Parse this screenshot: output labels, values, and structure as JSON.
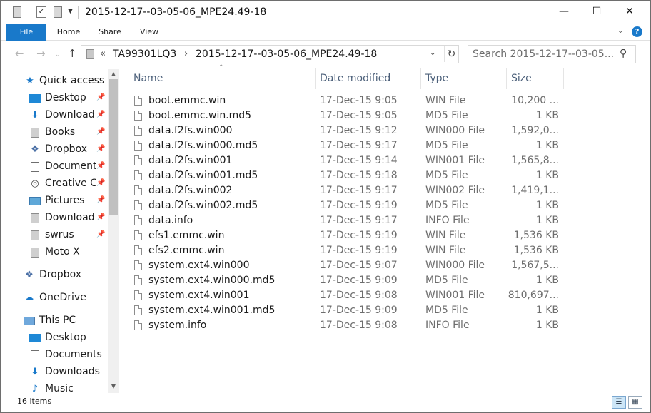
{
  "window": {
    "title": "2015-12-17--03-05-06_MPE24.49-18",
    "controls": {
      "minimize": "—",
      "maximize": "☐",
      "close": "✕"
    }
  },
  "ribbon": {
    "tabs": [
      {
        "label": "File",
        "active": true
      },
      {
        "label": "Home"
      },
      {
        "label": "Share"
      },
      {
        "label": "View"
      }
    ],
    "expand_icon": "chevron-down-icon",
    "help_icon": "help-icon"
  },
  "nav": {
    "back_icon": "arrow-left-icon",
    "forward_icon": "arrow-right-icon",
    "recent_icon": "chevron-down-icon",
    "up_icon": "arrow-up-icon",
    "breadcrumb": {
      "overflow": "«",
      "segments": [
        "TA99301LQ3",
        "2015-12-17--03-05-06_MPE24.49-18"
      ],
      "separator": "›"
    },
    "search_placeholder": "Search 2015-12-17--03-05...",
    "search_value": ""
  },
  "sidebar": {
    "items": [
      {
        "label": "Quick access",
        "icon": "star-icon",
        "level": 0,
        "pinned": false
      },
      {
        "label": "Desktop",
        "icon": "desktop-icon",
        "level": 1,
        "pinned": true
      },
      {
        "label": "Download",
        "icon": "download-icon",
        "level": 1,
        "pinned": true
      },
      {
        "label": "Books",
        "icon": "folder-icon",
        "level": 1,
        "pinned": true
      },
      {
        "label": "Dropbox",
        "icon": "dropbox-icon",
        "level": 1,
        "pinned": true
      },
      {
        "label": "Document",
        "icon": "documents-icon",
        "level": 1,
        "pinned": true
      },
      {
        "label": "Creative C",
        "icon": "creative-cloud-icon",
        "level": 1,
        "pinned": true
      },
      {
        "label": "Pictures",
        "icon": "pictures-icon",
        "level": 1,
        "pinned": true
      },
      {
        "label": "Download",
        "icon": "folder-icon",
        "level": 1,
        "pinned": true
      },
      {
        "label": "swrus",
        "icon": "folder-icon",
        "level": 1,
        "pinned": true
      },
      {
        "label": "Moto X",
        "icon": "folder-icon",
        "level": 1,
        "pinned": false
      },
      {
        "label": "Dropbox",
        "icon": "dropbox-icon",
        "level": 0,
        "pinned": false
      },
      {
        "label": "OneDrive",
        "icon": "onedrive-icon",
        "level": 0,
        "pinned": false
      },
      {
        "label": "This PC",
        "icon": "computer-icon",
        "level": 0,
        "pinned": false
      },
      {
        "label": "Desktop",
        "icon": "desktop-icon",
        "level": 1,
        "pinned": false
      },
      {
        "label": "Documents",
        "icon": "documents-icon",
        "level": 1,
        "pinned": false
      },
      {
        "label": "Downloads",
        "icon": "download-icon",
        "level": 1,
        "pinned": false
      },
      {
        "label": "Music",
        "icon": "music-icon",
        "level": 1,
        "pinned": false
      }
    ]
  },
  "filelist": {
    "columns": [
      {
        "label": "Name"
      },
      {
        "label": "Date modified"
      },
      {
        "label": "Type"
      },
      {
        "label": "Size"
      }
    ],
    "sort_indicator": "^",
    "rows": [
      {
        "name": "boot.emmc.win",
        "date": "17-Dec-15 9:05",
        "type": "WIN File",
        "size": "10,200 ..."
      },
      {
        "name": "boot.emmc.win.md5",
        "date": "17-Dec-15 9:05",
        "type": "MD5 File",
        "size": "1 KB"
      },
      {
        "name": "data.f2fs.win000",
        "date": "17-Dec-15 9:12",
        "type": "WIN000 File",
        "size": "1,592,0..."
      },
      {
        "name": "data.f2fs.win000.md5",
        "date": "17-Dec-15 9:17",
        "type": "MD5 File",
        "size": "1 KB"
      },
      {
        "name": "data.f2fs.win001",
        "date": "17-Dec-15 9:14",
        "type": "WIN001 File",
        "size": "1,565,8..."
      },
      {
        "name": "data.f2fs.win001.md5",
        "date": "17-Dec-15 9:18",
        "type": "MD5 File",
        "size": "1 KB"
      },
      {
        "name": "data.f2fs.win002",
        "date": "17-Dec-15 9:17",
        "type": "WIN002 File",
        "size": "1,419,1..."
      },
      {
        "name": "data.f2fs.win002.md5",
        "date": "17-Dec-15 9:19",
        "type": "MD5 File",
        "size": "1 KB"
      },
      {
        "name": "data.info",
        "date": "17-Dec-15 9:17",
        "type": "INFO File",
        "size": "1 KB"
      },
      {
        "name": "efs1.emmc.win",
        "date": "17-Dec-15 9:19",
        "type": "WIN File",
        "size": "1,536 KB"
      },
      {
        "name": "efs2.emmc.win",
        "date": "17-Dec-15 9:19",
        "type": "WIN File",
        "size": "1,536 KB"
      },
      {
        "name": "system.ext4.win000",
        "date": "17-Dec-15 9:07",
        "type": "WIN000 File",
        "size": "1,567,5..."
      },
      {
        "name": "system.ext4.win000.md5",
        "date": "17-Dec-15 9:09",
        "type": "MD5 File",
        "size": "1 KB"
      },
      {
        "name": "system.ext4.win001",
        "date": "17-Dec-15 9:08",
        "type": "WIN001 File",
        "size": "810,697..."
      },
      {
        "name": "system.ext4.win001.md5",
        "date": "17-Dec-15 9:09",
        "type": "MD5 File",
        "size": "1 KB"
      },
      {
        "name": "system.info",
        "date": "17-Dec-15 9:08",
        "type": "INFO File",
        "size": "1 KB"
      }
    ]
  },
  "status": {
    "item_count": "16 items"
  },
  "colors": {
    "accent": "#1979ca",
    "header_text": "#4c607a",
    "secondary_text": "#6d6d6d"
  }
}
